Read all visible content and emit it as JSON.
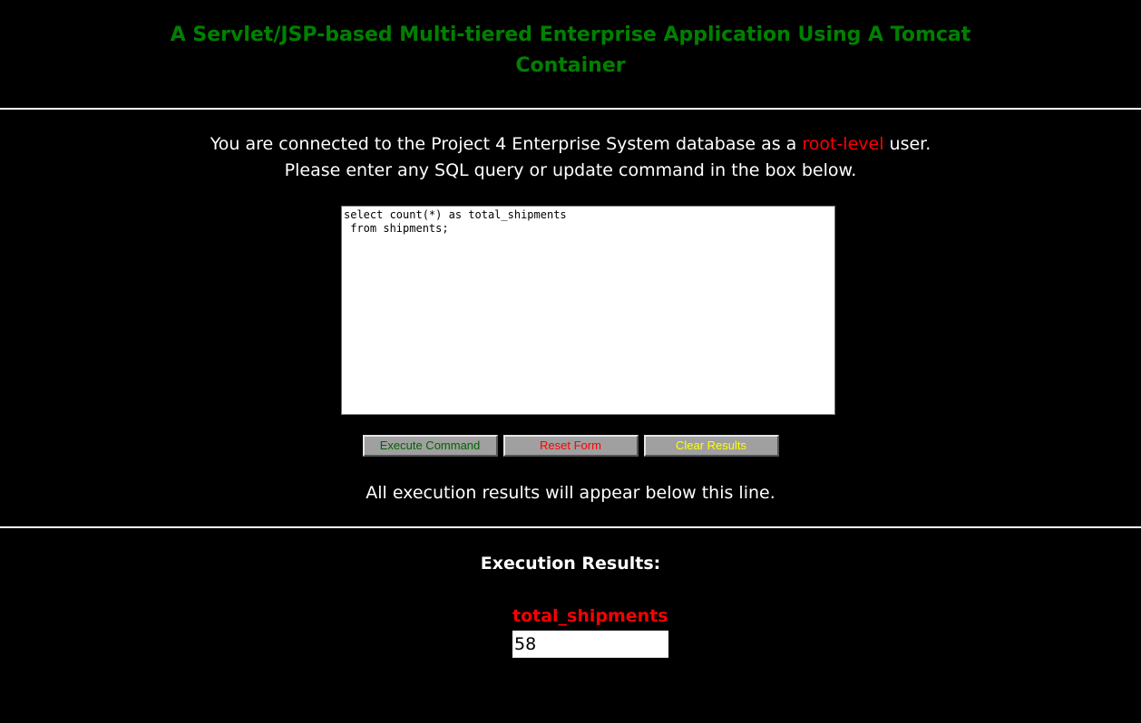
{
  "header": {
    "title_line1": "A Servlet/JSP-based Multi-tiered Enterprise Application Using A Tomcat",
    "title_line2": "Container"
  },
  "intro": {
    "line1_prefix": "You are connected to the Project 4 Enterprise System database as a ",
    "line1_highlight": "root-level",
    "line1_suffix": " user.",
    "line2": "Please enter any SQL query or update command in the box below."
  },
  "query": {
    "value": "select count(*) as total_shipments\n from shipments;"
  },
  "buttons": {
    "execute_label": "Execute Command",
    "reset_label": "Reset Form",
    "clear_label": "Clear Results"
  },
  "results_note": "All execution results will appear below this line.",
  "results": {
    "heading": "Execution Results:",
    "columns": [
      "total_shipments"
    ],
    "rows": [
      [
        "58"
      ]
    ]
  },
  "colors": {
    "background": "#000000",
    "title": "#008000",
    "highlight": "#ff0000",
    "execute_text": "#006400",
    "reset_text": "#ff0000",
    "clear_text": "#ffff00",
    "button_bg": "#a0a0a0"
  }
}
